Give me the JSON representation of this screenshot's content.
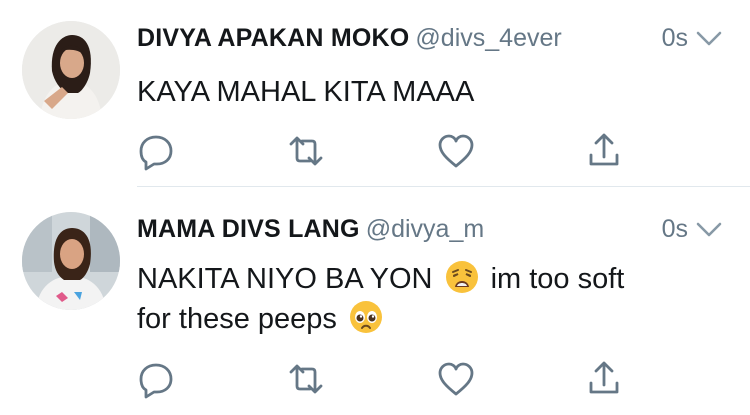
{
  "tweets": [
    {
      "name": "DIVYA APAKAN MOKO",
      "handle": "@divs_4ever",
      "time": "0s",
      "text_line1": "KAYA MAHAL KITA MAAA"
    },
    {
      "name": "MAMA DIVS LANG",
      "handle": "@divya_m",
      "time": "0s",
      "text_line1_a": "NAKITA NIYO BA YON",
      "text_line1_b": "im too soft",
      "text_line2": "for these peeps"
    }
  ],
  "icons": [
    "reply-icon",
    "retweet-icon",
    "like-icon",
    "share-icon",
    "chevron-down-icon",
    "weary-face-emoji",
    "pleading-face-emoji"
  ],
  "colors": {
    "icon_gray": "#657786",
    "text": "#14171a",
    "divider": "#e1e8ed",
    "emoji_yellow": "#f9c23c"
  }
}
